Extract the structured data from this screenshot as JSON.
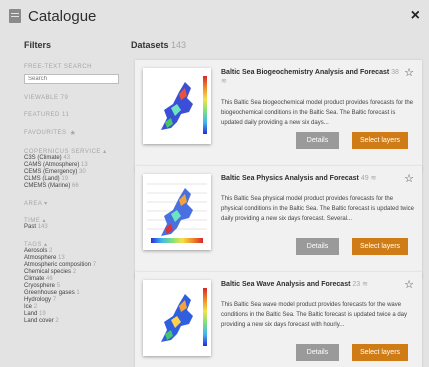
{
  "header": {
    "title": "Catalogue",
    "close": "×"
  },
  "sidebar": {
    "filters_title": "Filters",
    "free_text_label": "FREE-TEXT SEARCH",
    "search_placeholder": "Search",
    "viewable": "VIEWABLE 79",
    "featured": "FEATURED 11",
    "favourites": "FAVOURITES",
    "copernicus_label": "COPERNICUS SERVICE ▴",
    "services": [
      {
        "name": "C3S (Climate)",
        "count": "43"
      },
      {
        "name": "CAMS (Atmosphere)",
        "count": "13"
      },
      {
        "name": "CEMS (Emergency)",
        "count": "30"
      },
      {
        "name": "CLMS (Land)",
        "count": "19"
      },
      {
        "name": "CMEMS (Marine)",
        "count": "66"
      }
    ],
    "area_label": "AREA ▾",
    "time_label": "TIME ▴",
    "time_items": [
      {
        "name": "Past",
        "count": "143"
      }
    ],
    "tags_label": "TAGS ▴",
    "tags": [
      {
        "name": "Aerosols",
        "count": "2"
      },
      {
        "name": "Atmosphere",
        "count": "13"
      },
      {
        "name": "Atmospheric composition",
        "count": "7"
      },
      {
        "name": "Chemical species",
        "count": "2"
      },
      {
        "name": "Climate",
        "count": "46"
      },
      {
        "name": "Cryosphere",
        "count": "5"
      },
      {
        "name": "Greenhouse gases",
        "count": "1"
      },
      {
        "name": "Hydrology",
        "count": "7"
      },
      {
        "name": "Ice",
        "count": "2"
      },
      {
        "name": "Land",
        "count": "19"
      },
      {
        "name": "Land cover",
        "count": "2"
      }
    ]
  },
  "main": {
    "datasets_label": "Datasets",
    "datasets_count": "143",
    "cards": [
      {
        "title": "Baltic Sea Biogeochemistry Analysis and Forecast",
        "count": "38",
        "desc": "This Baltic Sea biogeochemical model product provides forecasts for the biogeochemical conditions in the Baltic Sea. The Baltic forecast is updated daily providing a new six days...",
        "details": "Details",
        "select": "Select layers"
      },
      {
        "title": "Baltic Sea Physics Analysis and Forecast",
        "count": "49",
        "desc": "This Baltic Sea physical model product provides forecasts for the physical conditions in the Baltic Sea. The Baltic forecast is updated twice daily providing a new six days forecast. Several...",
        "details": "Details",
        "select": "Select layers"
      },
      {
        "title": "Baltic Sea Wave Analysis and Forecast",
        "count": "23",
        "desc": "This Baltic Sea wave model product provides forecasts for the wave conditions in the Baltic Sea. The Baltic forecast is updated twice a day providing a new six days forecast with hourly...",
        "details": "Details",
        "select": "Select layers"
      }
    ]
  },
  "icons": {
    "catalogue": "catalogue-icon",
    "close": "close-icon",
    "star": "star-outline-icon",
    "favourite": "star-filled-icon",
    "layers": "layers-icon"
  },
  "colors": {
    "accent": "#cf7c17",
    "details_button": "#9a9a9a",
    "panel": "#e3e3e3",
    "card": "#f1f1f1"
  }
}
